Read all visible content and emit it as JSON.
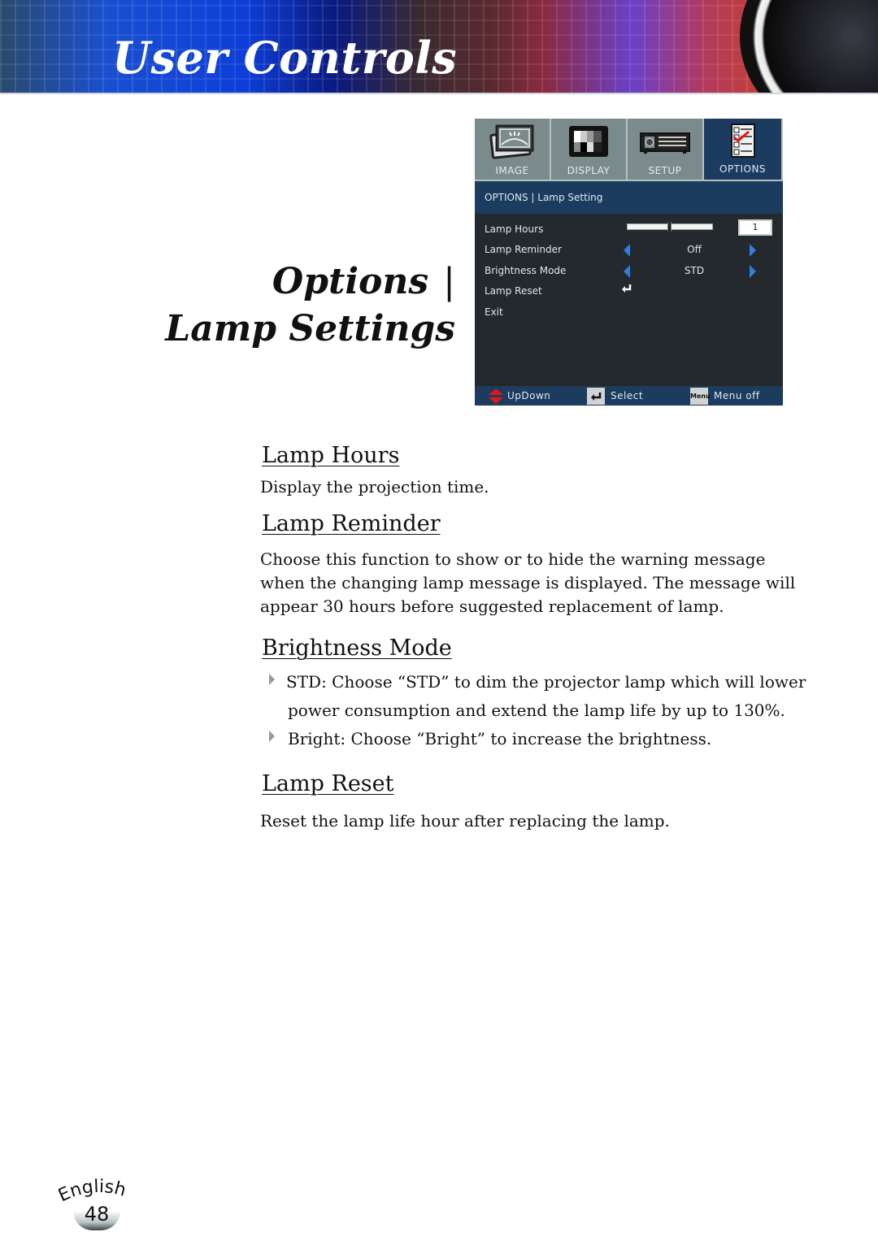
{
  "header": {
    "title": "User Controls"
  },
  "section_title": {
    "line1": "Options",
    "separator": "|",
    "line2": "Lamp Settings"
  },
  "osd": {
    "tabs": [
      {
        "label": "IMAGE",
        "icon": "image-icon",
        "active": false
      },
      {
        "label": "DISPLAY",
        "icon": "display-icon",
        "active": false
      },
      {
        "label": "SETUP",
        "icon": "projector-icon",
        "active": false
      },
      {
        "label": "OPTIONS",
        "icon": "checklist-icon",
        "active": true
      }
    ],
    "breadcrumb": "OPTIONS | Lamp Setting",
    "rows": [
      {
        "name": "Lamp Hours",
        "control": "slider",
        "value": "1",
        "slider_fraction": 0.47
      },
      {
        "name": "Lamp Reminder",
        "control": "selector",
        "value": "Off"
      },
      {
        "name": "Brightness Mode",
        "control": "selector",
        "value": "STD"
      },
      {
        "name": "Lamp Reset",
        "control": "enter"
      },
      {
        "name": "Exit",
        "control": "none"
      }
    ],
    "footer": {
      "updown": "UpDown",
      "select": "Select",
      "menu_key": "Menu",
      "menu_off": "Menu off"
    },
    "colors": {
      "panel": "#23292c",
      "bar": "#1b3c5e",
      "tab": "#7b8a8a",
      "arrow": "#2f7fd8"
    }
  },
  "content": {
    "lamp_hours": {
      "heading": "Lamp Hours",
      "text": "Display the projection time."
    },
    "lamp_reminder": {
      "heading": "Lamp Reminder",
      "lines": [
        "Choose this function to show or to hide the warning message",
        "when the changing lamp message is displayed. The message will",
        "appear 30 hours before suggested replacement of lamp."
      ]
    },
    "brightness_mode": {
      "heading": "Brightness Mode",
      "bullets": [
        {
          "lines": [
            "STD: Choose “STD” to dim the projector lamp which will lower",
            "power consumption and extend the lamp life by up to 130%."
          ]
        },
        {
          "lines": [
            "Bright: Choose “Bright” to increase the brightness."
          ]
        }
      ]
    },
    "lamp_reset": {
      "heading": "Lamp Reset",
      "text": "Reset the lamp life hour after replacing the lamp."
    }
  },
  "page": {
    "language": "English",
    "number": "48"
  }
}
